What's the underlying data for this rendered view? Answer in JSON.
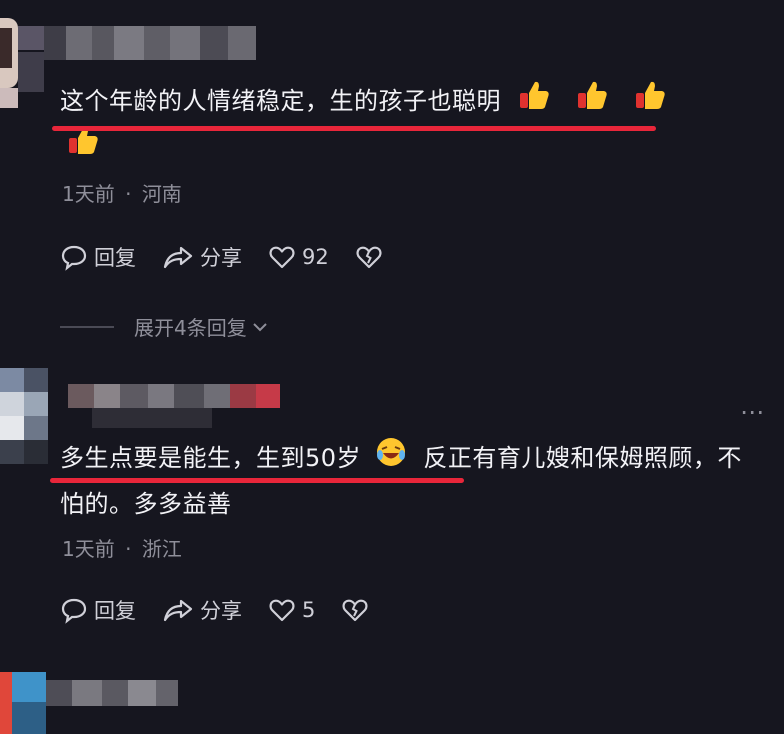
{
  "comments": [
    {
      "text": "这个年龄的人情绪稳定，生的孩子也聪明",
      "time": "1天前",
      "sep": "·",
      "location": "河南",
      "reply_label": "回复",
      "share_label": "分享",
      "like_count": "92",
      "expand_label": "展开4条回复"
    },
    {
      "text_part1": "多生点要是能生，生到50岁",
      "text_part2": "反正有育儿嫂和保姆照顾，不怕的。多多益善",
      "time": "1天前",
      "sep": "·",
      "location": "浙江",
      "reply_label": "回复",
      "share_label": "分享",
      "like_count": "5"
    }
  ],
  "colors": {
    "background": "#16161f",
    "underline": "#e8263a",
    "meta": "#8f8f9a"
  },
  "icons": [
    "thumbs-up-icon",
    "laughing-emoji-icon",
    "comment-bubble-icon",
    "share-arrow-icon",
    "heart-icon",
    "broken-heart-icon",
    "chevron-down-icon",
    "more-dots-icon"
  ]
}
